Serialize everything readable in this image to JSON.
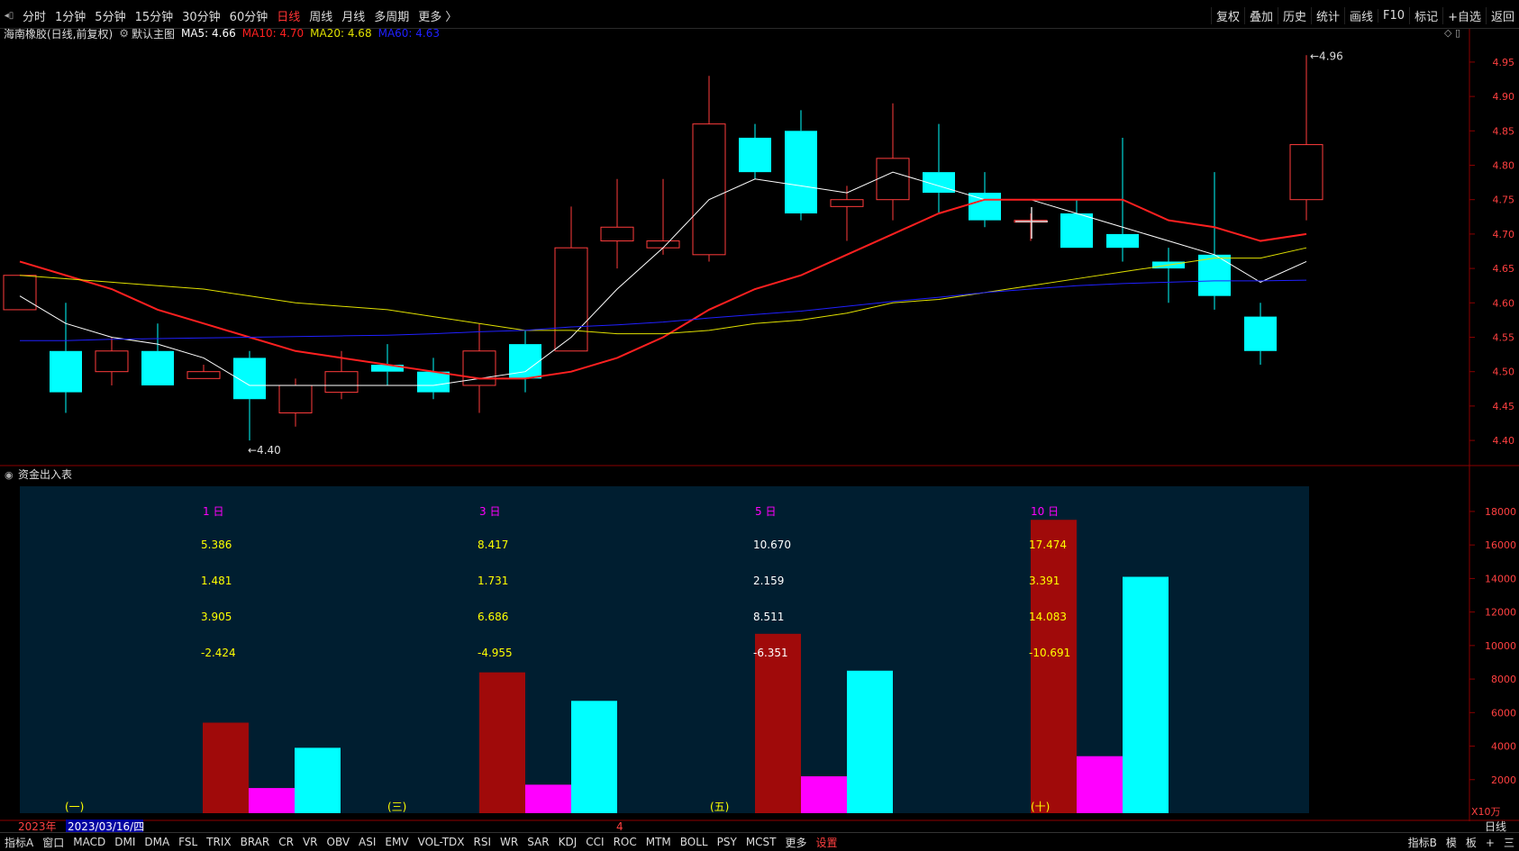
{
  "toolbar": {
    "periods": [
      "分时",
      "1分钟",
      "5分钟",
      "15分钟",
      "30分钟",
      "60分钟",
      "日线",
      "周线",
      "月线",
      "多周期",
      "更多 〉"
    ],
    "active_period": "日线",
    "tools": [
      "复权",
      "叠加",
      "历史",
      "统计",
      "画线",
      "F10",
      "标记",
      "+自选",
      "返回"
    ]
  },
  "header": {
    "stock": "海南橡胶(日线,前复权)",
    "main_chart": "默认主图",
    "ma5": "MA5: 4.66",
    "ma10": "MA10: 4.70",
    "ma20": "MA20: 4.68",
    "ma60": "MA60: 4.63"
  },
  "sub_panel": {
    "title": "资金出入表",
    "unit": "X10万",
    "period_label": "日线"
  },
  "timeline": {
    "year": "2023年",
    "selected_date": "2023/03/16/四",
    "month_mark": "4"
  },
  "bottom_tabs": [
    "指标A",
    "窗口",
    "MACD",
    "DMI",
    "DMA",
    "FSL",
    "TRIX",
    "BRAR",
    "CR",
    "VR",
    "OBV",
    "ASI",
    "EMV",
    "VOL-TDX",
    "RSI",
    "WR",
    "SAR",
    "KDJ",
    "CCI",
    "ROC",
    "MTM",
    "BOLL",
    "PSY",
    "MCST",
    "更多",
    "设置"
  ],
  "bottom_right": [
    "指标B",
    "模",
    "板",
    "+",
    "三"
  ],
  "colors": {
    "up": "#ff3c3c",
    "down": "#00ffff",
    "ma5": "#ffffff",
    "ma10": "#ff2020",
    "ma20": "#e0e000",
    "ma60": "#2020ff",
    "inflow": "#a00a0a",
    "mid": "#ff00ff",
    "outflow": "#00ffff",
    "panel_bg": "#001e30"
  },
  "chart_data": [
    {
      "type": "candlestick",
      "title": "海南橡胶(日线,前复权)",
      "ylim": [
        4.37,
        4.98
      ],
      "yticks": [
        4.4,
        4.45,
        4.5,
        4.55,
        4.6,
        4.65,
        4.7,
        4.75,
        4.8,
        4.85,
        4.9,
        4.95
      ],
      "candles": [
        {
          "o": 4.59,
          "c": 4.64,
          "h": 4.64,
          "l": 4.59
        },
        {
          "o": 4.53,
          "c": 4.47,
          "h": 4.6,
          "l": 4.44
        },
        {
          "o": 4.5,
          "c": 4.53,
          "h": 4.55,
          "l": 4.48
        },
        {
          "o": 4.53,
          "c": 4.48,
          "h": 4.57,
          "l": 4.48
        },
        {
          "o": 4.49,
          "c": 4.5,
          "h": 4.51,
          "l": 4.49
        },
        {
          "o": 4.52,
          "c": 4.46,
          "h": 4.53,
          "l": 4.4
        },
        {
          "o": 4.44,
          "c": 4.48,
          "h": 4.49,
          "l": 4.42
        },
        {
          "o": 4.47,
          "c": 4.5,
          "h": 4.53,
          "l": 4.46
        },
        {
          "o": 4.51,
          "c": 4.5,
          "h": 4.54,
          "l": 4.48
        },
        {
          "o": 4.5,
          "c": 4.47,
          "h": 4.52,
          "l": 4.46
        },
        {
          "o": 4.48,
          "c": 4.53,
          "h": 4.57,
          "l": 4.44
        },
        {
          "o": 4.54,
          "c": 4.49,
          "h": 4.56,
          "l": 4.47
        },
        {
          "o": 4.53,
          "c": 4.68,
          "h": 4.74,
          "l": 4.53
        },
        {
          "o": 4.69,
          "c": 4.71,
          "h": 4.78,
          "l": 4.65
        },
        {
          "o": 4.68,
          "c": 4.69,
          "h": 4.78,
          "l": 4.67
        },
        {
          "o": 4.67,
          "c": 4.86,
          "h": 4.93,
          "l": 4.66
        },
        {
          "o": 4.84,
          "c": 4.79,
          "h": 4.86,
          "l": 4.78
        },
        {
          "o": 4.85,
          "c": 4.73,
          "h": 4.88,
          "l": 4.72
        },
        {
          "o": 4.74,
          "c": 4.75,
          "h": 4.77,
          "l": 4.69
        },
        {
          "o": 4.75,
          "c": 4.81,
          "h": 4.89,
          "l": 4.72
        },
        {
          "o": 4.79,
          "c": 4.76,
          "h": 4.86,
          "l": 4.73
        },
        {
          "o": 4.76,
          "c": 4.72,
          "h": 4.79,
          "l": 4.71
        },
        {
          "o": 4.72,
          "c": 4.72,
          "h": 4.73,
          "l": 4.69
        },
        {
          "o": 4.73,
          "c": 4.68,
          "h": 4.75,
          "l": 4.68
        },
        {
          "o": 4.7,
          "c": 4.68,
          "h": 4.84,
          "l": 4.66
        },
        {
          "o": 4.66,
          "c": 4.65,
          "h": 4.68,
          "l": 4.6
        },
        {
          "o": 4.67,
          "c": 4.61,
          "h": 4.79,
          "l": 4.59
        },
        {
          "o": 4.58,
          "c": 4.53,
          "h": 4.6,
          "l": 4.51
        },
        {
          "o": 4.75,
          "c": 4.83,
          "h": 4.96,
          "l": 4.72
        }
      ],
      "series": [
        {
          "name": "MA5",
          "values": [
            4.61,
            4.57,
            4.55,
            4.54,
            4.52,
            4.48,
            4.48,
            4.48,
            4.48,
            4.48,
            4.49,
            4.5,
            4.55,
            4.62,
            4.68,
            4.75,
            4.78,
            4.77,
            4.76,
            4.79,
            4.77,
            4.75,
            4.75,
            4.73,
            4.71,
            4.69,
            4.67,
            4.63,
            4.66
          ]
        },
        {
          "name": "MA10",
          "values": [
            4.66,
            4.64,
            4.62,
            4.59,
            4.57,
            4.55,
            4.53,
            4.52,
            4.51,
            4.5,
            4.49,
            4.49,
            4.5,
            4.52,
            4.55,
            4.59,
            4.62,
            4.64,
            4.67,
            4.7,
            4.73,
            4.75,
            4.75,
            4.75,
            4.75,
            4.72,
            4.71,
            4.69,
            4.7
          ]
        },
        {
          "name": "MA20",
          "values": [
            4.64,
            4.635,
            4.63,
            4.625,
            4.62,
            4.61,
            4.6,
            4.595,
            4.59,
            4.58,
            4.57,
            4.56,
            4.56,
            4.555,
            4.555,
            4.56,
            4.57,
            4.575,
            4.585,
            4.6,
            4.605,
            4.615,
            4.625,
            4.635,
            4.645,
            4.655,
            4.665,
            4.665,
            4.68
          ]
        },
        {
          "name": "MA60",
          "values": [
            4.545,
            4.545,
            4.547,
            4.548,
            4.549,
            4.55,
            4.551,
            4.552,
            4.553,
            4.555,
            4.558,
            4.56,
            4.565,
            4.568,
            4.572,
            4.578,
            4.583,
            4.588,
            4.595,
            4.602,
            4.608,
            4.615,
            4.62,
            4.625,
            4.628,
            4.63,
            4.632,
            4.632,
            4.633
          ]
        }
      ],
      "annotations": [
        {
          "label": "4.96"
        },
        {
          "label": "4.40"
        }
      ]
    },
    {
      "type": "bar",
      "title": "资金出入表",
      "ylim": [
        0,
        19500
      ],
      "yticks": [
        2000,
        4000,
        6000,
        8000,
        10000,
        12000,
        14000,
        16000,
        18000
      ],
      "groups": [
        {
          "header": "1 日",
          "label": "(一)",
          "rows": [
            "5.386",
            "1.481",
            "3.905",
            "-2.424"
          ],
          "values": [
            5400,
            1500,
            3900
          ]
        },
        {
          "header": "3 日",
          "label": "(三)",
          "rows": [
            "8.417",
            "1.731",
            "6.686",
            "-4.955"
          ],
          "values": [
            8400,
            1700,
            6700
          ]
        },
        {
          "header": "5 日",
          "label": "(五)",
          "rows": [
            "10.670",
            "2.159",
            "8.511",
            "-6.351"
          ],
          "values": [
            10700,
            2200,
            8500
          ]
        },
        {
          "header": "10 日",
          "label": "(十)",
          "rows": [
            "17.474",
            "3.391",
            "14.083",
            "-10.691"
          ],
          "values": [
            17500,
            3400,
            14100
          ]
        }
      ]
    }
  ]
}
